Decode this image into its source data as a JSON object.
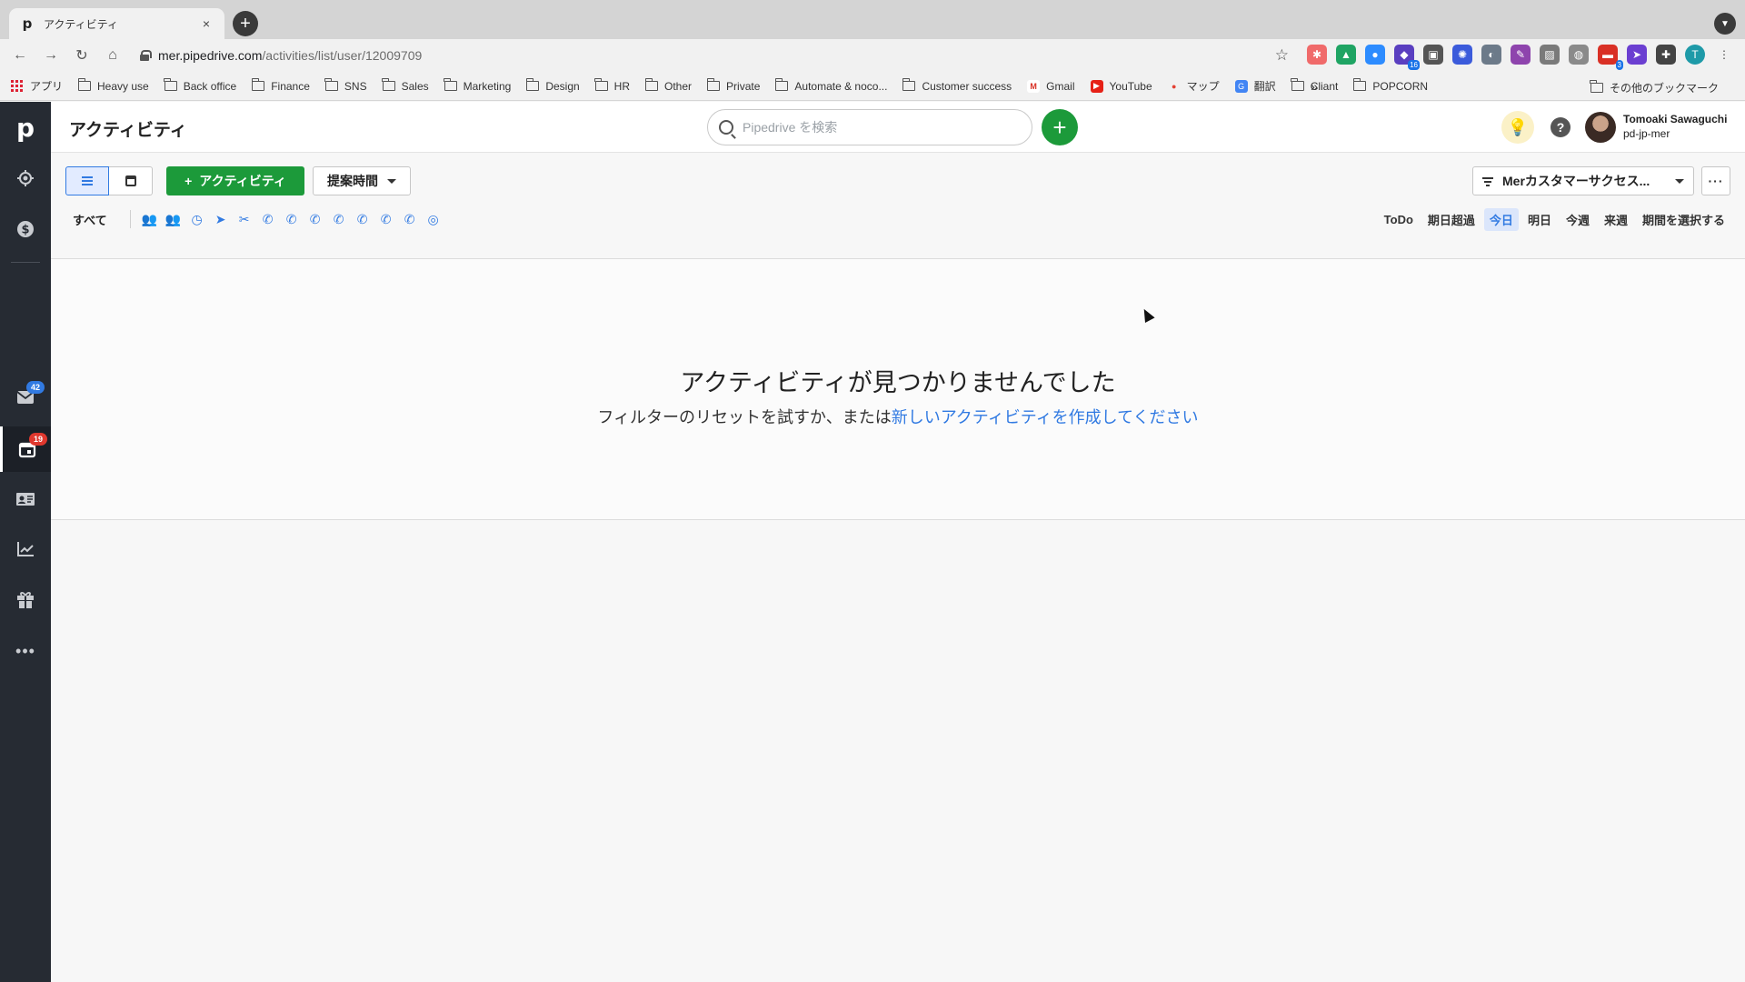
{
  "browser": {
    "tab": {
      "favicon": "p",
      "title": "アクティビティ",
      "close": "×"
    },
    "new_tab": "+",
    "url_host": "mer.pipedrive.com",
    "url_path": "/activities/list/user/12009709",
    "extensions": [
      {
        "name": "asana-icon",
        "color": "#f06a6a",
        "glyph": "✱"
      },
      {
        "name": "drive-icon",
        "color": "#1fa463",
        "glyph": "▲"
      },
      {
        "name": "zoom-icon",
        "color": "#2d8cff",
        "glyph": "●"
      },
      {
        "name": "ext-badge-icon",
        "color": "#5a3fc0",
        "glyph": "◆",
        "badge": "16"
      },
      {
        "name": "save-icon",
        "color": "#555555",
        "glyph": "▣"
      },
      {
        "name": "gear-ext-icon",
        "color": "#3b5bdb",
        "glyph": "✺"
      },
      {
        "name": "compass-icon",
        "color": "#6c7a89",
        "glyph": "◐"
      },
      {
        "name": "pen-icon",
        "color": "#8e44ad",
        "glyph": "✎"
      },
      {
        "name": "image-icon",
        "color": "#7a7a7a",
        "glyph": "▨"
      },
      {
        "name": "mask-icon",
        "color": "#8a8a8a",
        "glyph": "◍"
      },
      {
        "name": "todo-icon",
        "color": "#d93025",
        "glyph": "▬",
        "badge": "3"
      },
      {
        "name": "send-icon",
        "color": "#6b3fd1",
        "glyph": "➤"
      },
      {
        "name": "puzzle-icon",
        "color": "#444444",
        "glyph": "✚"
      }
    ],
    "profile_initial": "T"
  },
  "bookmarks": {
    "apps": "アプリ",
    "folders": [
      "Heavy use",
      "Back office",
      "Finance",
      "SNS",
      "Sales",
      "Marketing",
      "Design",
      "HR",
      "Other",
      "Private",
      "Automate & noco...",
      "Customer success"
    ],
    "gmail": "Gmail",
    "youtube": "YouTube",
    "maps": "マップ",
    "translate": "翻訳",
    "folders2": [
      "Cliant",
      "POPCORN"
    ],
    "more": "»",
    "other": "その他のブックマーク"
  },
  "sidebar": {
    "logo": "p",
    "mail_badge": "42",
    "activities_badge": "19"
  },
  "header": {
    "title": "アクティビティ",
    "search_placeholder": "Pipedrive を検索",
    "add": "+",
    "user_name": "Tomoaki Sawaguchi",
    "user_company": "pd-jp-mer",
    "help": "?"
  },
  "controls": {
    "add_activity": "アクティビティ",
    "add_plus": "+",
    "sort_label": "提案時間",
    "filter_label": "Merカスタマーサクセス...",
    "more": "···",
    "type_all": "すべて",
    "type_icons": [
      {
        "name": "meeting-icon",
        "glyph": "👥"
      },
      {
        "name": "group-icon",
        "glyph": "👥"
      },
      {
        "name": "deadline-icon",
        "glyph": "◷"
      },
      {
        "name": "email-type-icon",
        "glyph": "➤"
      },
      {
        "name": "lunch-icon",
        "glyph": "✂"
      },
      {
        "name": "call-icon",
        "glyph": "✆"
      },
      {
        "name": "call-icon",
        "glyph": "✆"
      },
      {
        "name": "call-icon",
        "glyph": "✆"
      },
      {
        "name": "call-icon",
        "glyph": "✆"
      },
      {
        "name": "call-icon",
        "glyph": "✆"
      },
      {
        "name": "call-icon",
        "glyph": "✆"
      },
      {
        "name": "call-icon",
        "glyph": "✆"
      },
      {
        "name": "globe-icon",
        "glyph": "◎"
      }
    ],
    "periods": [
      {
        "label": "ToDo",
        "active": false
      },
      {
        "label": "期日超過",
        "active": false
      },
      {
        "label": "今日",
        "active": true
      },
      {
        "label": "明日",
        "active": false
      },
      {
        "label": "今週",
        "active": false
      },
      {
        "label": "来週",
        "active": false
      },
      {
        "label": "期間を選択する",
        "active": false
      }
    ]
  },
  "empty_state": {
    "title": "アクティビティが見つかりませんでした",
    "text": "フィルターのリセットを試すか、または",
    "link": "新しいアクティビティを作成してください"
  }
}
